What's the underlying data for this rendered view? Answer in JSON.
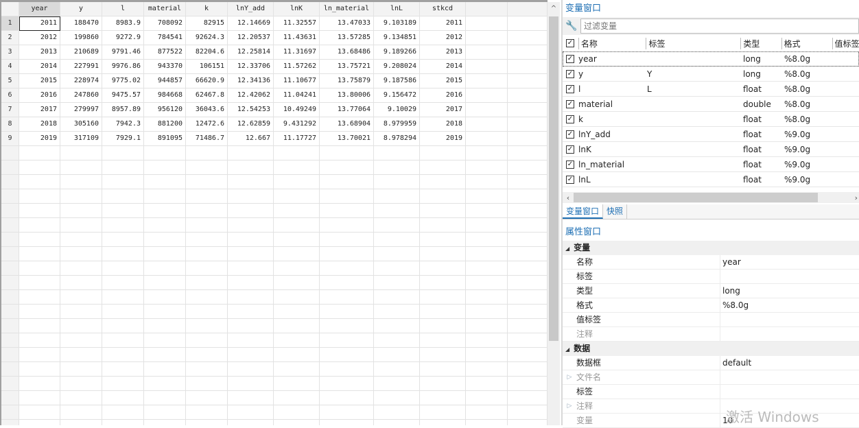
{
  "grid": {
    "columns": [
      "year",
      "y",
      "l",
      "material",
      "k",
      "lnY_add",
      "lnK",
      "ln_material",
      "lnL",
      "stkcd",
      "",
      ""
    ],
    "rows": [
      [
        "1",
        "2011",
        "188470",
        "8983.9",
        "708092",
        "82915",
        "12.14669",
        "11.32557",
        "13.47033",
        "9.103189",
        "2011"
      ],
      [
        "2",
        "2012",
        "199860",
        "9272.9",
        "784541",
        "92624.3",
        "12.20537",
        "11.43631",
        "13.57285",
        "9.134851",
        "2012"
      ],
      [
        "3",
        "2013",
        "210689",
        "9791.46",
        "877522",
        "82204.6",
        "12.25814",
        "11.31697",
        "13.68486",
        "9.189266",
        "2013"
      ],
      [
        "4",
        "2014",
        "227991",
        "9976.86",
        "943370",
        "106151",
        "12.33706",
        "11.57262",
        "13.75721",
        "9.208024",
        "2014"
      ],
      [
        "5",
        "2015",
        "228974",
        "9775.02",
        "944857",
        "66620.9",
        "12.34136",
        "11.10677",
        "13.75879",
        "9.187586",
        "2015"
      ],
      [
        "6",
        "2016",
        "247860",
        "9475.57",
        "984668",
        "62467.8",
        "12.42062",
        "11.04241",
        "13.80006",
        "9.156472",
        "2016"
      ],
      [
        "7",
        "2017",
        "279997",
        "8957.89",
        "956120",
        "36043.6",
        "12.54253",
        "10.49249",
        "13.77064",
        "9.10029",
        "2017"
      ],
      [
        "8",
        "2018",
        "305160",
        "7942.3",
        "881200",
        "12472.6",
        "12.62859",
        "9.431292",
        "13.68904",
        "8.979959",
        "2018"
      ],
      [
        "9",
        "2019",
        "317109",
        "7929.1",
        "891095",
        "71486.7",
        "12.667",
        "11.17727",
        "13.70021",
        "8.978294",
        "2019"
      ]
    ],
    "scroll_up": "^"
  },
  "variables": {
    "title": "变量窗口",
    "filter_placeholder": "过滤变量",
    "headers": {
      "check": "✓",
      "name": "名称",
      "label": "标签",
      "type": "类型",
      "format": "格式",
      "value_label": "值标签"
    },
    "items": [
      {
        "name": "year",
        "label": "",
        "type": "long",
        "format": "%8.0g"
      },
      {
        "name": "y",
        "label": "Y",
        "type": "long",
        "format": "%8.0g"
      },
      {
        "name": "l",
        "label": "L",
        "type": "float",
        "format": "%8.0g"
      },
      {
        "name": "material",
        "label": "",
        "type": "double",
        "format": "%8.0g"
      },
      {
        "name": "k",
        "label": "",
        "type": "float",
        "format": "%8.0g"
      },
      {
        "name": "lnY_add",
        "label": "",
        "type": "float",
        "format": "%9.0g"
      },
      {
        "name": "lnK",
        "label": "",
        "type": "float",
        "format": "%9.0g"
      },
      {
        "name": "ln_material",
        "label": "",
        "type": "float",
        "format": "%9.0g"
      },
      {
        "name": "lnL",
        "label": "",
        "type": "float",
        "format": "%9.0g"
      }
    ],
    "tabs": [
      "变量窗口",
      "快照"
    ]
  },
  "properties": {
    "title": "属性窗口",
    "sections": [
      {
        "title": "变量",
        "rows": [
          {
            "key": "名称",
            "value": "year"
          },
          {
            "key": "标签",
            "value": ""
          },
          {
            "key": "类型",
            "value": "long"
          },
          {
            "key": "格式",
            "value": "%8.0g"
          },
          {
            "key": "值标签",
            "value": ""
          },
          {
            "key": "注释",
            "value": "",
            "dim": true
          }
        ]
      },
      {
        "title": "数据",
        "rows": [
          {
            "key": "数据框",
            "value": "default"
          },
          {
            "key": "文件名",
            "value": "",
            "dim": true,
            "expand": true
          },
          {
            "key": "标签",
            "value": ""
          },
          {
            "key": "注释",
            "value": "",
            "dim": true,
            "expand": true
          },
          {
            "key": "变量",
            "value": "10",
            "dim": true
          }
        ]
      }
    ]
  },
  "watermark": "激活 Windows"
}
